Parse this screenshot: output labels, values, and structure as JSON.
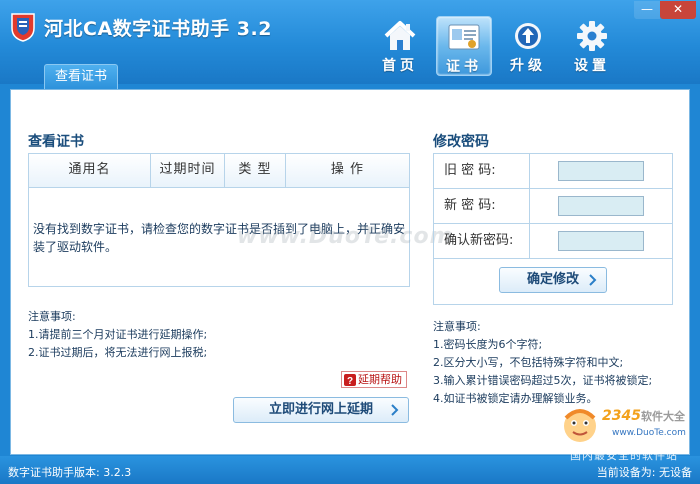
{
  "window": {
    "title": "河北CA数字证书助手 3.2",
    "min_glyph": "—",
    "close_glyph": "✕"
  },
  "nav": {
    "items": [
      {
        "label": "首页",
        "icon": "home-icon"
      },
      {
        "label": "证书",
        "icon": "certificate-icon",
        "active": true
      },
      {
        "label": "升级",
        "icon": "upgrade-icon"
      },
      {
        "label": "设置",
        "icon": "gear-icon"
      }
    ]
  },
  "subtab": {
    "label": "查看证书"
  },
  "cert": {
    "title": "查看证书",
    "columns": [
      "通用名",
      "过期时间",
      "类 型",
      "操 作"
    ],
    "empty_message": "没有找到数字证书，请检查您的数字证书是否插到了电脑上，并正确安装了驱动软件。",
    "notes": {
      "title": "注意事项:",
      "items": [
        "1.请提前三个月对证书进行延期操作;",
        "2.证书过期后，将无法进行网上报税;"
      ]
    },
    "help_label": "延期帮助",
    "renew_button": "立即进行网上延期"
  },
  "password": {
    "title": "修改密码",
    "fields": [
      {
        "label": "旧 密 码:",
        "value": ""
      },
      {
        "label": "新 密 码:",
        "value": ""
      },
      {
        "label": "确认新密码:",
        "value": ""
      }
    ],
    "submit_button": "确定修改",
    "notes": {
      "title": "注意事项:",
      "items": [
        "1.密码长度为6个字符;",
        "2.区分大小写，不包括特殊字符和中文;",
        "3.输入累计错误密码超过5次，证书将被锁定;",
        "4.如证书被锁定请办理解锁业务。"
      ]
    }
  },
  "watermark": "www.DuoTe.com",
  "logo": {
    "brand": "2345",
    "brand_cn": "软件大全",
    "site": "www.DuoTe.com"
  },
  "status": {
    "version": "数字证书助手版本: 3.2.3",
    "overlay": "国内最安全的软件站",
    "device": "当前设备为: 无设备"
  },
  "colors": {
    "accent": "#238ad8",
    "panel_border": "#7cb8e4",
    "input_bg": "#d9edf3"
  }
}
